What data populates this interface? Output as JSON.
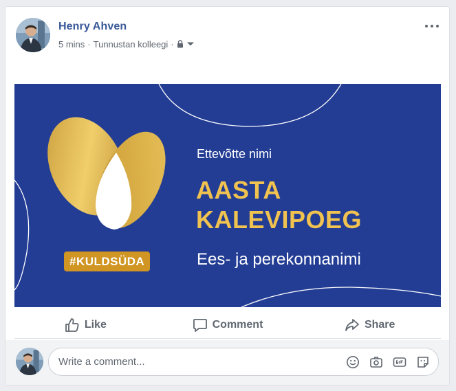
{
  "post": {
    "author": "Henry Ahven",
    "time": "5 mins",
    "separator": "·",
    "audience": "Tunnustan kolleegi",
    "privacy_icon": "lock-icon",
    "menu_icon": "more-options-icon"
  },
  "banner": {
    "hashtag": "#KULDSÜDA",
    "company": "Ettevõtte nimi",
    "award_line1": "AASTA",
    "award_line2": "KALEVIPOEG",
    "person": "Ees- ja perekonnanimi",
    "colors": {
      "background": "#233d94",
      "gold": "#f0c24f",
      "badge": "#d09522"
    }
  },
  "actions": {
    "like": "Like",
    "comment": "Comment",
    "share": "Share"
  },
  "comment_box": {
    "placeholder": "Write a comment...",
    "icons": [
      "emoji-icon",
      "camera-icon",
      "gif-icon",
      "sticker-icon"
    ]
  }
}
